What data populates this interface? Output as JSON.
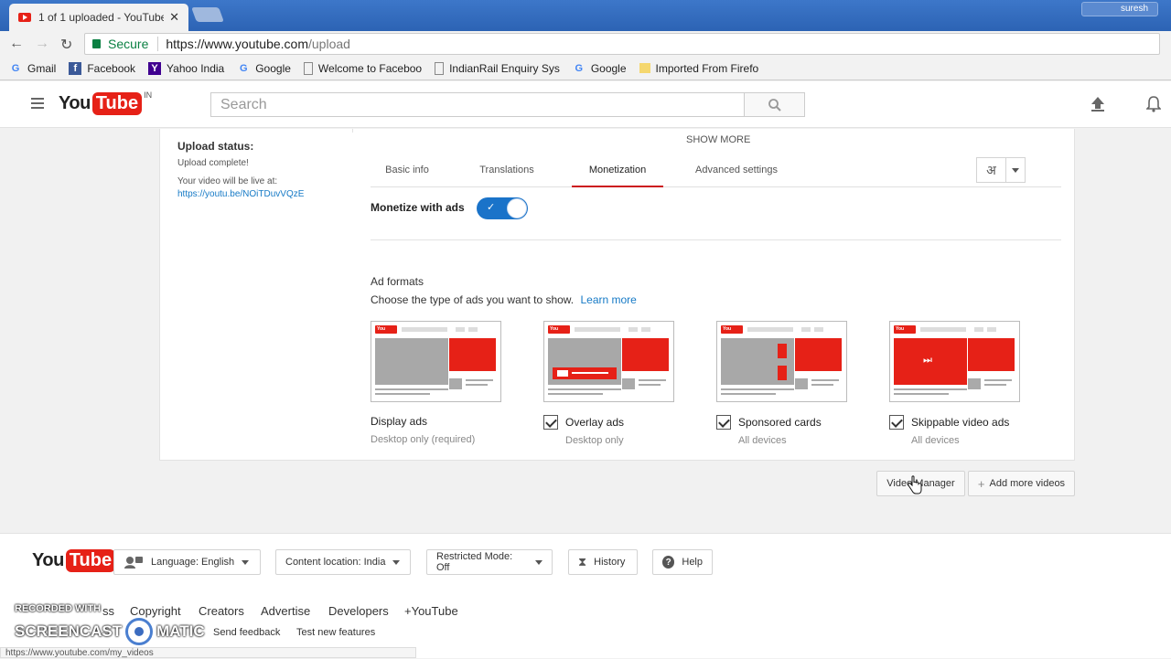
{
  "browser": {
    "tab_title": "1 of 1 uploaded - YouTube",
    "tab_close": "✕",
    "user_name": "suresh",
    "secure_label": "Secure",
    "url_host": "https://www.youtube.com",
    "url_path": "/upload",
    "bookmarks": [
      {
        "label": "Gmail",
        "icon": "google-g-icon"
      },
      {
        "label": "Facebook",
        "icon": "facebook-icon"
      },
      {
        "label": "Yahoo India",
        "icon": "yahoo-icon"
      },
      {
        "label": "Google",
        "icon": "google-g-icon"
      },
      {
        "label": "Welcome to Faceboo",
        "icon": "page-icon"
      },
      {
        "label": "IndianRail Enquiry Sys",
        "icon": "page-icon"
      },
      {
        "label": "Google",
        "icon": "google-g-icon"
      },
      {
        "label": "Imported From Firefo",
        "icon": "folder-icon"
      }
    ]
  },
  "header": {
    "logo_you": "You",
    "logo_tube": "Tube",
    "logo_country": "IN",
    "search_placeholder": "Search"
  },
  "upload": {
    "status_title": "Upload status:",
    "status_text": "Upload complete!",
    "live_text": "Your video will be live at:",
    "live_url": "https://youtu.be/NOiTDuvVQzE",
    "show_more": "SHOW MORE",
    "tabs": [
      "Basic info",
      "Translations",
      "Monetization",
      "Advanced settings"
    ],
    "active_tab": "Monetization",
    "lang_glyph": "अ",
    "monetize_label": "Monetize with ads",
    "monetize_on": true,
    "ad_formats_title": "Ad formats",
    "ad_formats_desc": "Choose the type of ads you want to show.",
    "learn_more": "Learn more",
    "formats": [
      {
        "name": "Display ads",
        "sub": "Desktop only (required)",
        "checked": false
      },
      {
        "name": "Overlay ads",
        "sub": "Desktop only",
        "checked": true
      },
      {
        "name": "Sponsored cards",
        "sub": "All devices",
        "checked": true
      },
      {
        "name": "Skippable video ads",
        "sub": "All devices",
        "checked": true
      }
    ]
  },
  "actions": {
    "video_manager": "Video Manager",
    "add_more": "Add more videos"
  },
  "footer": {
    "language": "Language: English",
    "content_location": "Content location: India",
    "restricted_mode": "Restricted Mode: Off",
    "history": "History",
    "help": "Help",
    "links": [
      "ss",
      "Copyright",
      "Creators",
      "Advertise",
      "Developers",
      "+YouTube"
    ],
    "links2": [
      "Send feedback",
      "Test new features"
    ]
  },
  "status_bar_url": "https://www.youtube.com/my_videos",
  "watermark": {
    "line1": "RECORDED WITH",
    "line2": "SCREENCAST",
    "line3": "MATIC"
  }
}
